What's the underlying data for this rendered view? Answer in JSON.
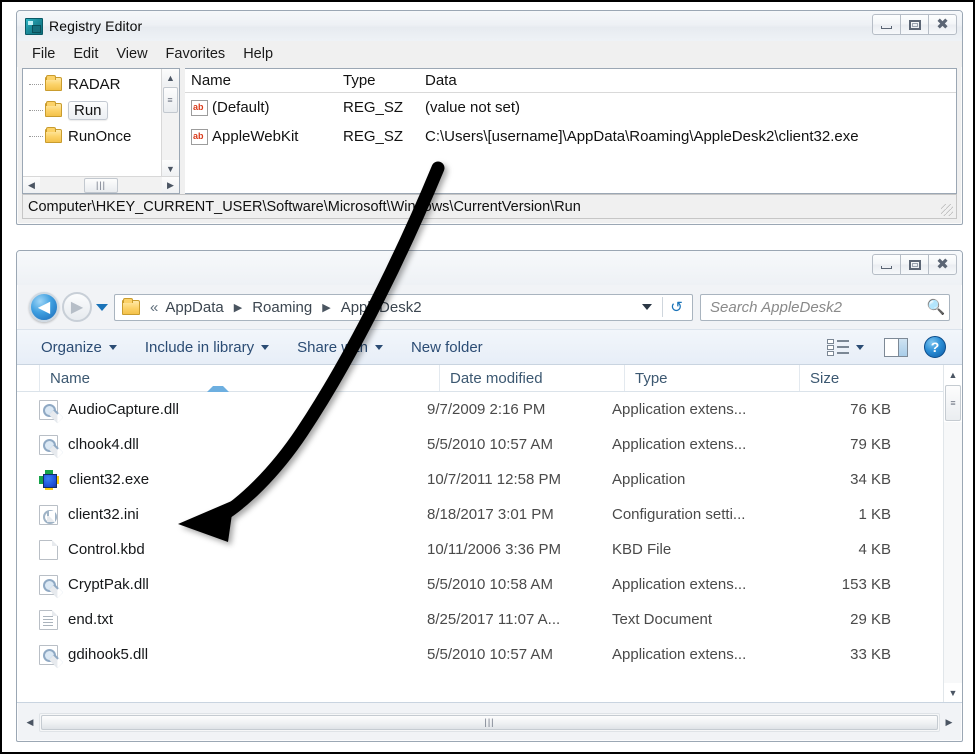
{
  "registry_editor": {
    "title": "Registry Editor",
    "icon": "registry-icon",
    "window_buttons": {
      "minimize": "—",
      "maximize": "□",
      "close": "✕"
    },
    "menu": [
      "File",
      "Edit",
      "View",
      "Favorites",
      "Help"
    ],
    "tree": {
      "items": [
        {
          "label": "RADAR",
          "selected": false
        },
        {
          "label": "Run",
          "selected": true
        },
        {
          "label": "RunOnce",
          "selected": false
        }
      ]
    },
    "value_list": {
      "headers": {
        "name": "Name",
        "type": "Type",
        "data": "Data"
      },
      "rows": [
        {
          "name": "(Default)",
          "type": "REG_SZ",
          "data": "(value not set)",
          "icon": "string-value-icon"
        },
        {
          "name": "AppleWebKit",
          "type": "REG_SZ",
          "data": "C:\\Users\\[username]\\AppData\\Roaming\\AppleDesk2\\client32.exe",
          "icon": "string-value-icon"
        }
      ]
    },
    "status_path": "Computer\\HKEY_CURRENT_USER\\Software\\Microsoft\\Windows\\CurrentVersion\\Run"
  },
  "explorer": {
    "title": "",
    "window_buttons": {
      "minimize": "—",
      "maximize": "□",
      "close": "✕"
    },
    "nav": {
      "back": "◀",
      "forward": "▶",
      "breadcrumb_chevron": "«",
      "crumbs": [
        "AppData",
        "Roaming",
        "AppleDesk2"
      ],
      "separator": "▶"
    },
    "search": {
      "placeholder": "Search AppleDesk2",
      "icon": "search-icon"
    },
    "toolbar": {
      "organize": "Organize",
      "include_in_library": "Include in library",
      "share_with": "Share with",
      "new_folder": "New folder",
      "view_icon": "view-layout-icon",
      "preview_pane_icon": "preview-pane-icon",
      "help_icon": "help-icon",
      "help_glyph": "?"
    },
    "columns": {
      "name": "Name",
      "date_modified": "Date modified",
      "type": "Type",
      "size": "Size"
    },
    "files": [
      {
        "name": "AudioCapture.dll",
        "date": "9/7/2009 2:16 PM",
        "type": "Application extens...",
        "size": "76 KB",
        "icon": "dll-file-icon"
      },
      {
        "name": "clhook4.dll",
        "date": "5/5/2010 10:57 AM",
        "type": "Application extens...",
        "size": "79 KB",
        "icon": "dll-file-icon"
      },
      {
        "name": "client32.exe",
        "date": "10/7/2011 12:58 PM",
        "type": "Application",
        "size": "34 KB",
        "icon": "application-exe-icon"
      },
      {
        "name": "client32.ini",
        "date": "8/18/2017 3:01 PM",
        "type": "Configuration setti...",
        "size": "1 KB",
        "icon": "ini-file-icon"
      },
      {
        "name": "Control.kbd",
        "date": "10/11/2006 3:36 PM",
        "type": "KBD File",
        "size": "4 KB",
        "icon": "generic-file-icon"
      },
      {
        "name": "CryptPak.dll",
        "date": "5/5/2010 10:58 AM",
        "type": "Application extens...",
        "size": "153 KB",
        "icon": "dll-file-icon"
      },
      {
        "name": "end.txt",
        "date": "8/25/2017 11:07 A...",
        "type": "Text Document",
        "size": "29 KB",
        "icon": "text-file-icon"
      },
      {
        "name": "gdihook5.dll",
        "date": "5/5/2010 10:57 AM",
        "type": "Application extens...",
        "size": "33 KB",
        "icon": "dll-file-icon"
      }
    ]
  },
  "annotation": {
    "shape": "curved-arrow",
    "color": "#000000",
    "points_from": "registry-data-value",
    "points_to": "client32.exe"
  }
}
